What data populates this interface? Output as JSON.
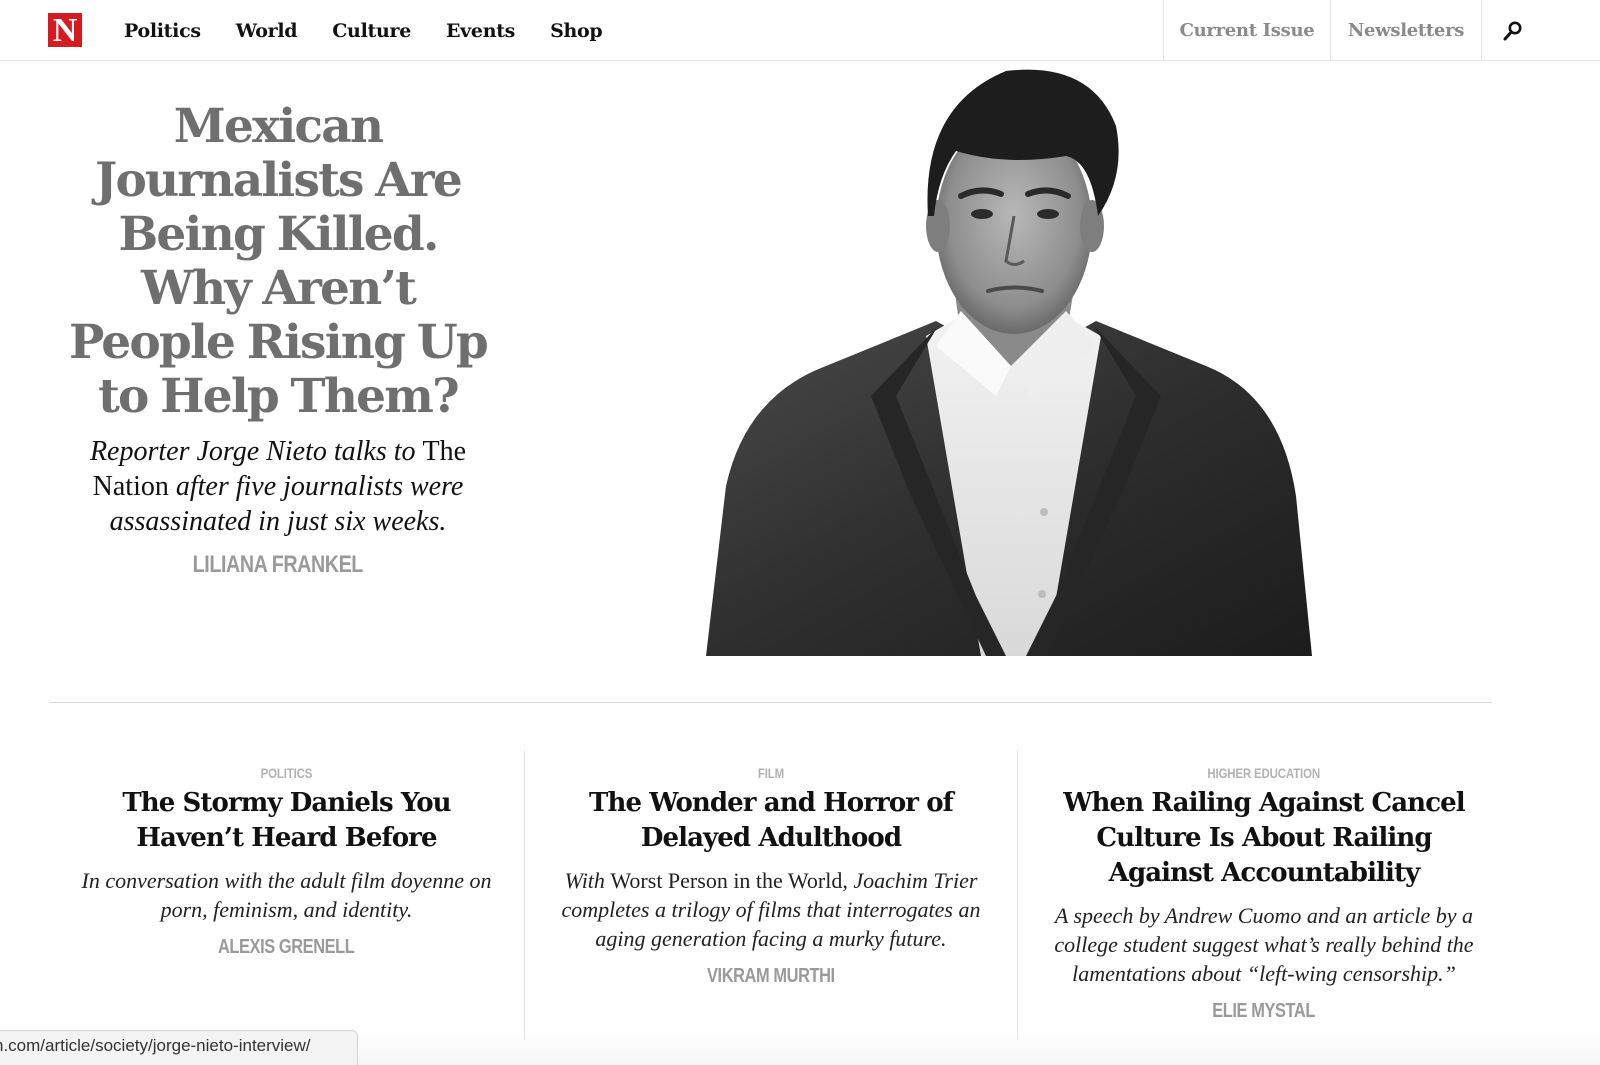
{
  "header": {
    "logo_letter": "N",
    "nav": [
      "Politics",
      "World",
      "Culture",
      "Events",
      "Shop"
    ],
    "current_issue": "Current Issue",
    "newsletters": "Newsletters",
    "search_icon": "search-icon"
  },
  "hero": {
    "title": "Mexican Journalists Are Being Killed. Why Aren’t People Rising Up to Help Them?",
    "dek_pre": "Reporter Jorge Nieto talks to ",
    "dek_publication": "The Nation",
    "dek_post": " after five journalists were assassinated in just six weeks.",
    "author": "LILIANA FRANKEL"
  },
  "articles": [
    {
      "kicker": "POLITICS",
      "title": "The Stormy Daniels You Haven’t Heard Before",
      "dek": "In conversation with the adult film doyenne on porn, feminism, and identity.",
      "author": "ALEXIS GRENELL"
    },
    {
      "kicker": "FILM",
      "title": "The Wonder and Horror of Delayed Adulthood",
      "dek_pre": "With ",
      "dek_film": "Worst Person in the World,",
      "dek_post": " Joachim Trier completes a trilogy of films that interrogates an aging generation facing a murky future.",
      "author": "VIKRAM MURTHI"
    },
    {
      "kicker": "HIGHER EDUCATION",
      "title": "When Railing Against Cancel Culture Is About Railing Against Accountability",
      "dek": "A speech by Andrew Cuomo and an article by a college student suggest what’s really behind the lamentations about “left-wing censorship.”",
      "author": "ELIE MYSTAL"
    }
  ],
  "status_url": "n.com/article/society/jorge-nieto-interview/"
}
